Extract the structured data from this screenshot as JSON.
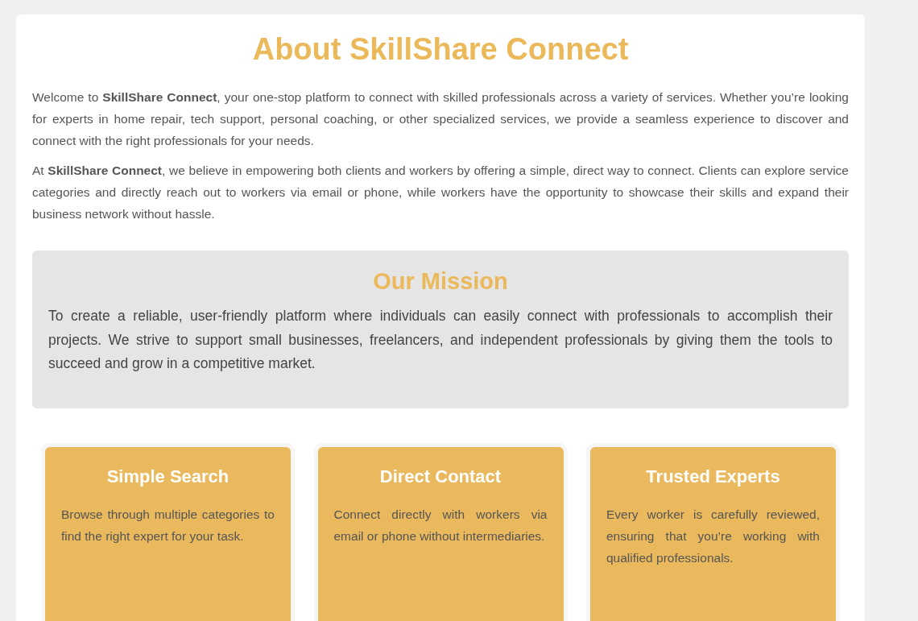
{
  "title": "About SkillShare Connect",
  "paragraphs": [
    "Welcome to **SkillShare Connect**, your one-stop platform to connect with skilled professionals across a variety of services. Whether you’re looking for experts in home repair, tech support, personal coaching, or other specialized services, we provide a seamless experience to discover and connect with the right professionals for your needs.",
    "At **SkillShare Connect**, we believe in empowering both clients and workers by offering a simple, direct way to connect. Clients can explore service categories and directly reach out to workers via email or phone, while workers have the opportunity to showcase their skills and expand their business network without hassle."
  ],
  "mission": {
    "heading": "Our Mission",
    "text": "To create a reliable, user-friendly platform where individuals can easily connect with professionals to accomplish their projects. We strive to support small businesses, freelancers, and independent professionals by giving them the tools to succeed and grow in a competitive market."
  },
  "features": [
    {
      "heading": "Simple Search",
      "text": "Browse through multiple categories to find the right expert for your task."
    },
    {
      "heading": "Direct Contact",
      "text": "Connect directly with workers via email or phone without intermediaries."
    },
    {
      "heading": "Trusted Experts",
      "text": "Every worker is carefully reviewed, ensuring that you’re working with qualified professionals."
    }
  ]
}
